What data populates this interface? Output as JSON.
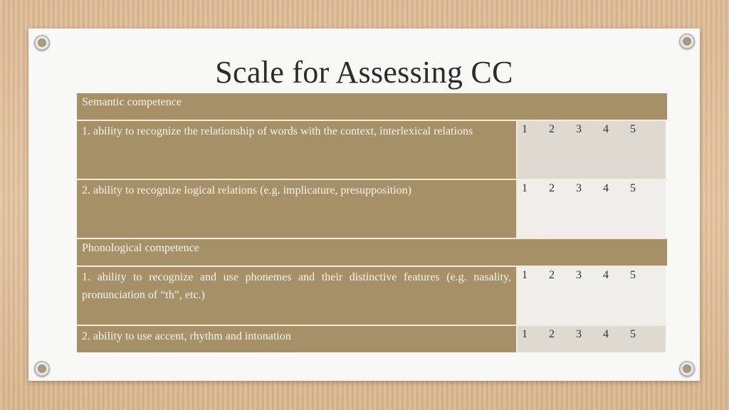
{
  "slide": {
    "title": "Scale for Assessing CC"
  },
  "table": {
    "sections": [
      {
        "heading": "Semantic competence",
        "items": [
          {
            "text": "1. ability to recognize the relationship of words with the context, interlexical relations",
            "scale": [
              "1",
              "2",
              "3",
              "4",
              "5"
            ]
          },
          {
            "text": "2. ability to recognize logical relations (e.g. implicature, presupposition)",
            "scale": [
              "1",
              "2",
              "3",
              "4",
              "5"
            ]
          }
        ]
      },
      {
        "heading": "Phonological competence",
        "items": [
          {
            "text": "1. ability to recognize and use phonemes and their distinctive features (e.g. nasality, pronunciation of “th”, etc.)",
            "scale": [
              "1",
              "2",
              "3",
              "4",
              "5"
            ]
          },
          {
            "text": "2. ability to use accent, rhythm and intonation",
            "scale": [
              "1",
              "2",
              "3",
              "4",
              "5"
            ]
          }
        ]
      }
    ]
  },
  "colors": {
    "header_bg": "#a69068",
    "header_text": "#fbf6ea",
    "scale_bg_dark": "#dedad1",
    "scale_bg_light": "#efeeeb"
  },
  "icons": [
    "grommet-icon"
  ]
}
